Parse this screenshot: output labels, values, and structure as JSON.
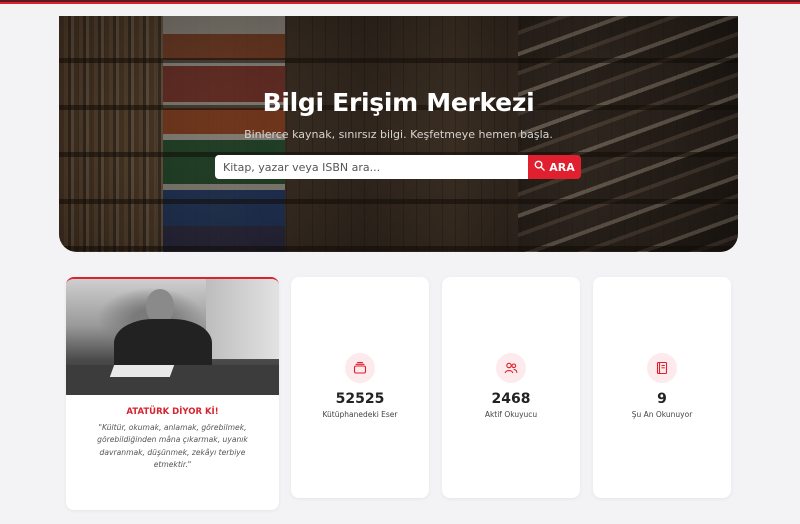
{
  "hero": {
    "title": "Bilgi Erişim Merkezi",
    "subtitle": "Binlerce kaynak, sınırsız bilgi. Keşfetmeye hemen başla.",
    "search": {
      "placeholder": "Kitap, yazar veya ISBN ara...",
      "value": "",
      "button_label": "ARA",
      "button_icon": "search-icon"
    }
  },
  "quote_card": {
    "heading": "ATATÜRK DİYOR Kİ!",
    "text": "\"Kültür, okumak, anlamak, görebilmek, görebildiğinden mâna çıkarmak, uyanık davranmak, düşünmek, zekâyı terbiye etmektir.\""
  },
  "stats": [
    {
      "icon": "book-stack-icon",
      "value": "52525",
      "label": "Kütüphanedeki Eser"
    },
    {
      "icon": "users-icon",
      "value": "2468",
      "label": "Aktif Okuyucu"
    },
    {
      "icon": "open-book-icon",
      "value": "9",
      "label": "Şu An Okunuyor"
    }
  ],
  "colors": {
    "accent": "#e0202e",
    "icon_bg": "#fdeaec",
    "page_bg": "#f3f3f5"
  }
}
